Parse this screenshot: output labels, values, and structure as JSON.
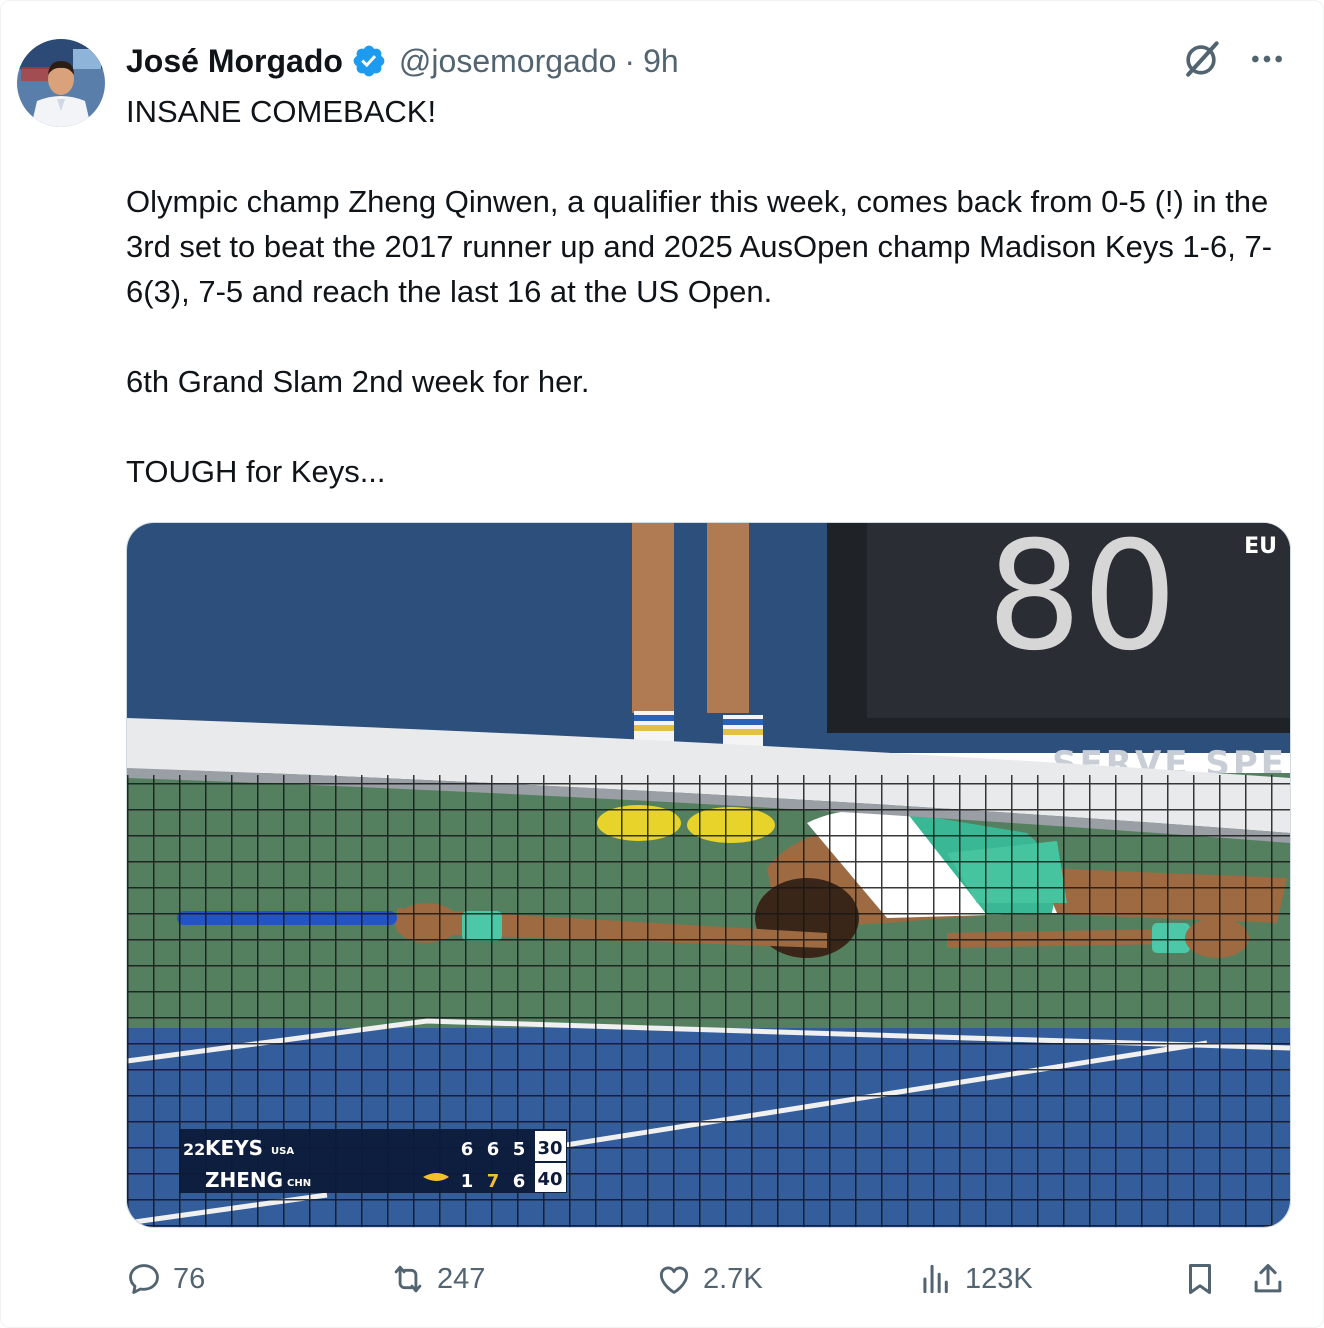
{
  "author": {
    "name": "José Morgado",
    "handle": "@josemorgado",
    "separator": "·",
    "time": "9h",
    "verified": true
  },
  "tweet": {
    "paragraphs": [
      "INSANE COMEBACK!",
      "Olympic champ Zheng Qinwen, a qualifier this week, comes back from 0-5 (!) in the 3rd set to beat the 2017 runner up and 2025 AusOpen champ Madison Keys 1-6, 7-6(3), 7-5 and reach the last 16 at the US Open.",
      "6th Grand Slam 2nd week for her.",
      "TOUGH for Keys..."
    ]
  },
  "media": {
    "speed_display": "80",
    "board_text": "SERVE SPE",
    "corner_logo": "EU",
    "scoreboard": {
      "players": [
        {
          "seed": "22",
          "name": "KEYS",
          "country": "USA",
          "sets": [
            "6",
            "6",
            "5"
          ],
          "points": "30",
          "serving": false
        },
        {
          "seed": "",
          "name": "ZHENG",
          "country": "CHN",
          "sets": [
            "1",
            "7",
            "6"
          ],
          "points": "40",
          "serving": true
        }
      ]
    }
  },
  "actions": {
    "replies": "76",
    "reposts": "247",
    "likes": "2.7K",
    "views": "123K"
  },
  "icons": {
    "verified": "verified-badge-icon",
    "grok": "grok-icon",
    "more": "more-icon",
    "reply": "reply-icon",
    "repost": "repost-icon",
    "like": "heart-icon",
    "views": "views-icon",
    "bookmark": "bookmark-icon",
    "share": "share-icon"
  },
  "colors": {
    "accent": "#1d9bf0",
    "muted": "#536471",
    "court_green": "#4e7a5a",
    "court_blue": "#345d9c"
  }
}
